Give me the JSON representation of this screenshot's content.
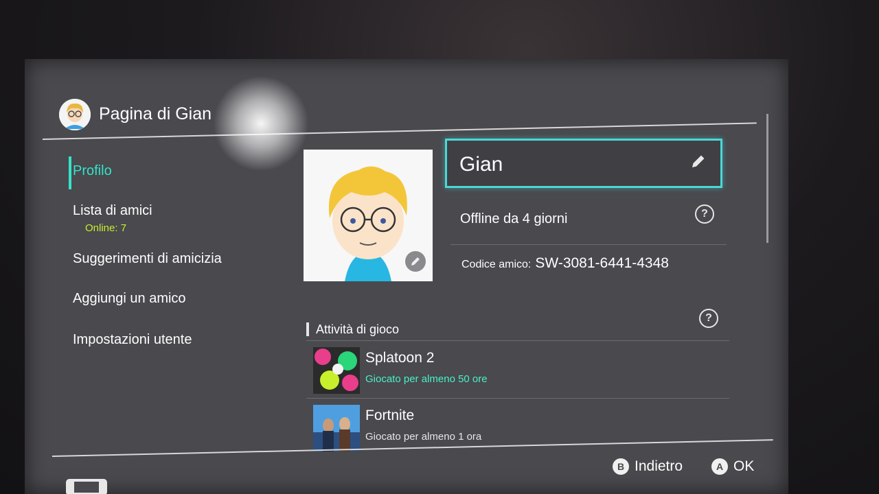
{
  "header": {
    "title": "Pagina di Gian"
  },
  "sidebar": {
    "items": [
      {
        "label": "Profilo"
      },
      {
        "label": "Lista di amici",
        "sub": "Online: 7"
      },
      {
        "label": "Suggerimenti di amicizia"
      },
      {
        "label": "Aggiungi un amico"
      },
      {
        "label": "Impostazioni utente"
      }
    ]
  },
  "profile": {
    "name": "Gian",
    "status": "Offline da 4 giorni",
    "friend_code_label": "Codice amico:",
    "friend_code": "SW-3081-6441-4348"
  },
  "activity": {
    "title": "Attività di gioco",
    "games": [
      {
        "title": "Splatoon 2",
        "playtime": "Giocato per almeno 50 ore",
        "playtime_color": "#49f0c8"
      },
      {
        "title": "Fortnite",
        "playtime": "Giocato per almeno 1 ora",
        "playtime_color": "#e6e6e6"
      }
    ]
  },
  "footer": {
    "back_button": "B",
    "back_label": "Indietro",
    "ok_button": "A",
    "ok_label": "OK"
  },
  "colors": {
    "accent": "#35e3c8",
    "online": "#c7ef2c",
    "focus_border": "#49d9d6",
    "screen_bg": "#49494e"
  }
}
